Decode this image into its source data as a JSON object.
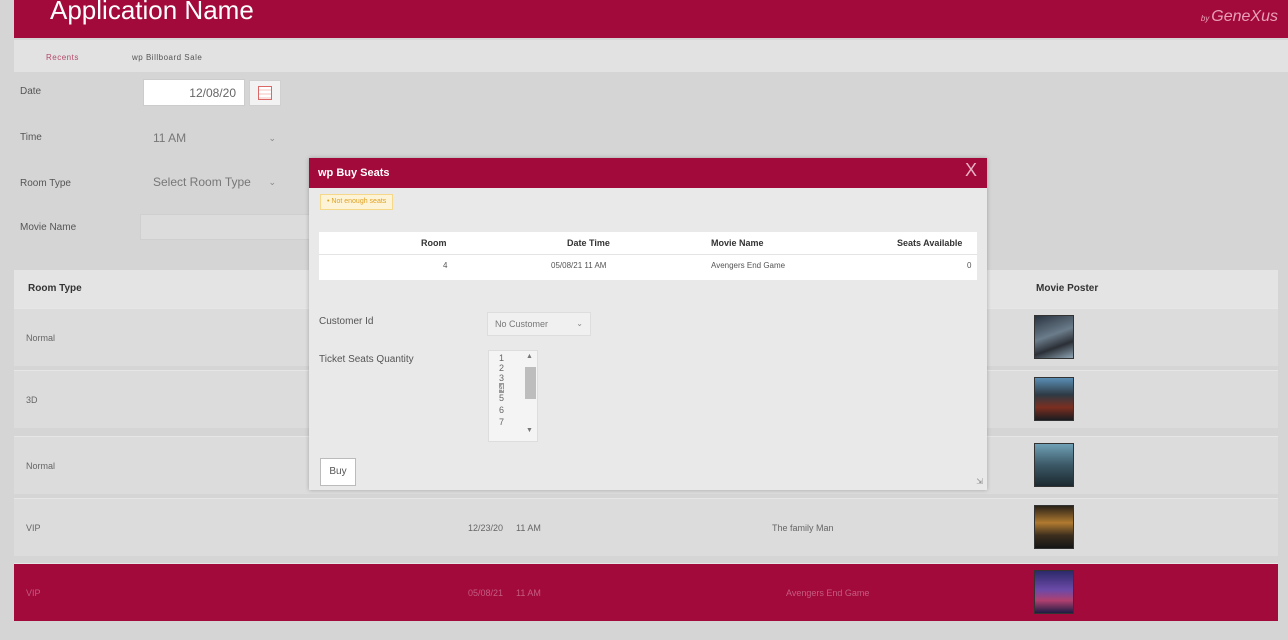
{
  "header": {
    "app_title": "Application Name",
    "brand_prefix": "by",
    "brand_name": "GeneXus"
  },
  "breadcrumb": {
    "items": [
      "Recents",
      "wp Billboard Sale"
    ]
  },
  "form": {
    "date_label": "Date",
    "date_value": "12/08/20",
    "time_label": "Time",
    "time_value": "11 AM",
    "room_type_label": "Room Type",
    "room_type_value": "Select Room Type",
    "movie_name_label": "Movie Name"
  },
  "grid": {
    "headers": {
      "room_type": "Room Type",
      "movie_poster": "Movie Poster"
    },
    "rows": [
      {
        "room_type": "Normal",
        "date": "",
        "time": "",
        "movie": ""
      },
      {
        "room_type": "3D",
        "date": "",
        "time": "",
        "movie": ""
      },
      {
        "room_type": "Normal",
        "date": "",
        "time": "",
        "movie": ""
      },
      {
        "room_type": "VIP",
        "date": "12/23/20",
        "time": "11 AM",
        "movie": "The family Man"
      },
      {
        "room_type": "VIP",
        "date": "05/08/21",
        "time": "11 AM",
        "movie": "Avengers End Game"
      }
    ],
    "selected_row_index": 4
  },
  "modal": {
    "title": "wp Buy Seats",
    "close_label": "X",
    "warning": "Not enough seats",
    "table": {
      "headers": {
        "room": "Room",
        "date_time": "Date Time",
        "movie_name": "Movie Name",
        "seats_available": "Seats Available"
      },
      "row": {
        "room": "4",
        "date_time": "05/08/21 11 AM",
        "movie_name": "Avengers End Game",
        "seats_available": "0"
      }
    },
    "customer_label": "Customer Id",
    "customer_value": "No Customer",
    "ticket_label": "Ticket Seats Quantity",
    "ticket_options": [
      "1",
      "2",
      "3",
      "4",
      "5",
      "6",
      "7"
    ],
    "ticket_selected": "4",
    "buy_label": "Buy"
  },
  "colors": {
    "brand": "#a30a3c",
    "background": "#d5d5d5",
    "warning_bg": "#fdf4d8",
    "warning_text": "#e0a020"
  }
}
